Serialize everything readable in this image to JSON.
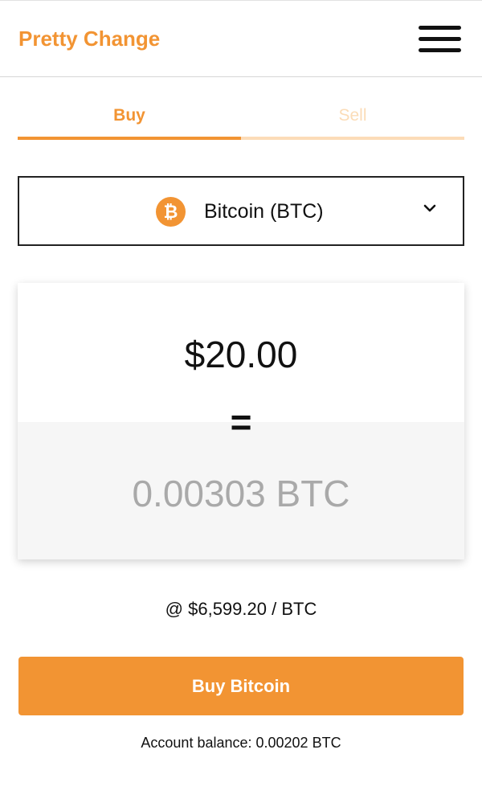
{
  "header": {
    "brand": "Pretty Change",
    "menu_icon": "hamburger-menu-icon"
  },
  "tabs": [
    {
      "label": "Buy",
      "active": true
    },
    {
      "label": "Sell",
      "active": false
    }
  ],
  "currency_select": {
    "icon": "bitcoin-icon",
    "icon_glyph": "₿",
    "selected": "Bitcoin (BTC)",
    "chevron_icon": "chevron-down-icon"
  },
  "conversion": {
    "usd_amount": "$20.00",
    "equals": "=",
    "btc_amount": "0.00303 BTC"
  },
  "rate": "@ $6,599.20 / BTC",
  "buy_button_label": "Buy Bitcoin",
  "balance": "Account balance: 0.00202 BTC",
  "colors": {
    "accent": "#f29433",
    "accent_light": "#fcdcb8"
  }
}
